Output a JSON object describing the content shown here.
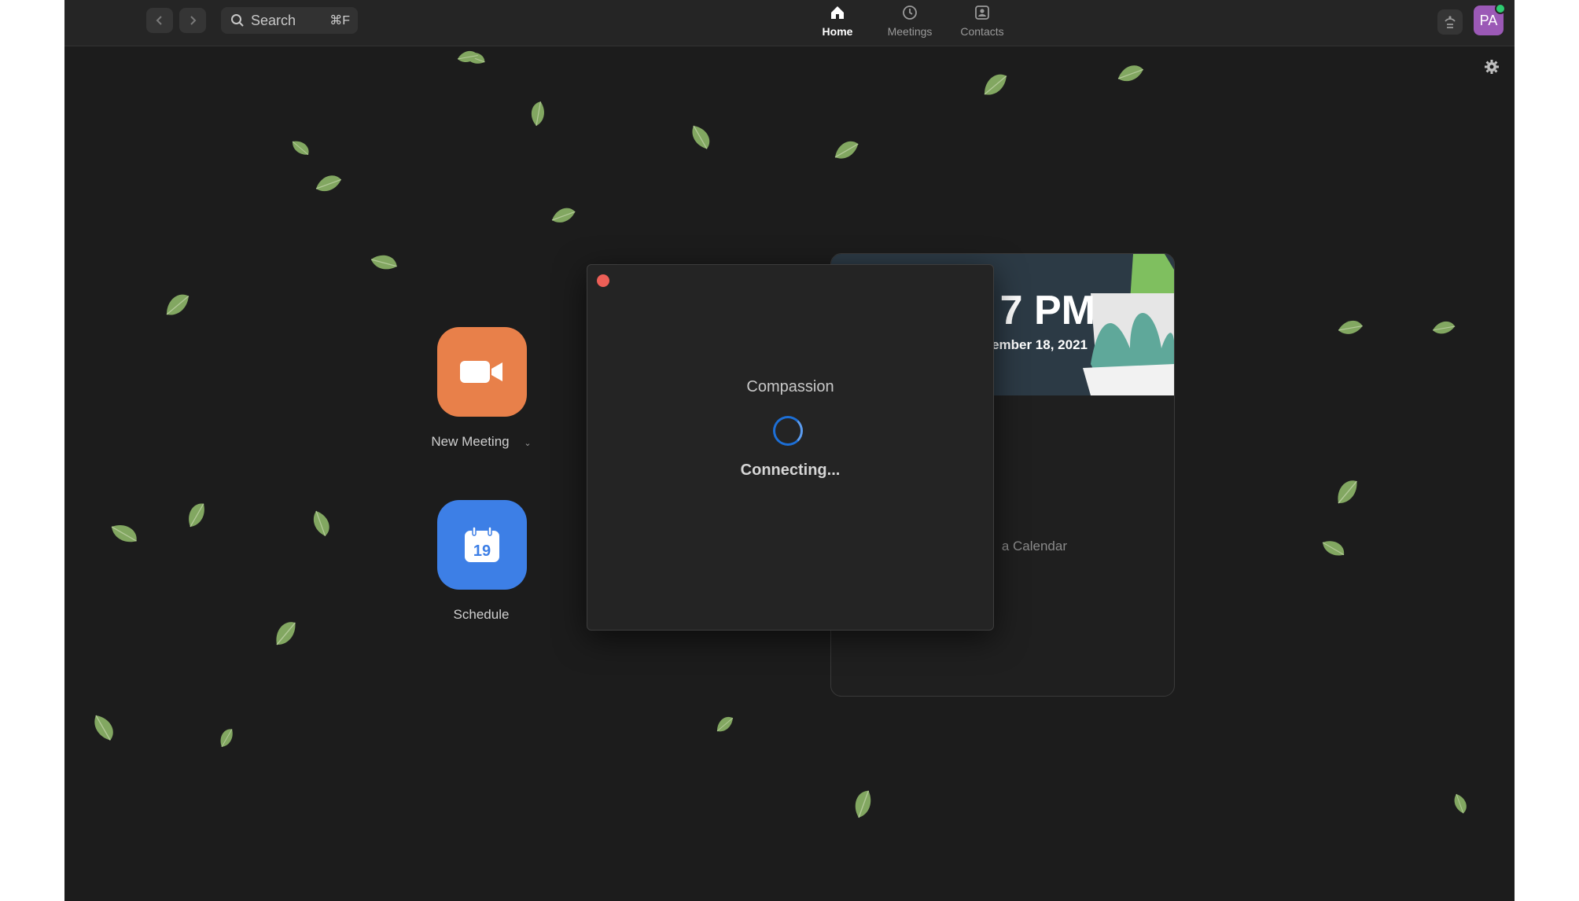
{
  "topbar": {
    "search": {
      "label": "Search",
      "shortcut": "⌘F"
    },
    "tabs": [
      {
        "label": "Home",
        "icon": "home-icon",
        "active": true
      },
      {
        "label": "Meetings",
        "icon": "clock-icon",
        "active": false
      },
      {
        "label": "Contacts",
        "icon": "contacts-icon",
        "active": false
      }
    ],
    "avatar": {
      "initials": "PA",
      "color": "#9b59b6",
      "status_color": "#2ecc71"
    }
  },
  "actions": {
    "new_meeting": {
      "label": "New Meeting",
      "color": "#e8804a"
    },
    "schedule": {
      "label": "Schedule",
      "calendar_day": "19",
      "color": "#3d7fe6"
    }
  },
  "calendar_card": {
    "time": "7 PM",
    "date": "vember 18, 2021",
    "empty_text": "a Calendar"
  },
  "dialog": {
    "title": "Compassion",
    "status": "Connecting..."
  },
  "colors": {
    "background": "#1c1c1c",
    "accent_blue": "#1d6fd6",
    "close_red": "#ed5f57"
  }
}
